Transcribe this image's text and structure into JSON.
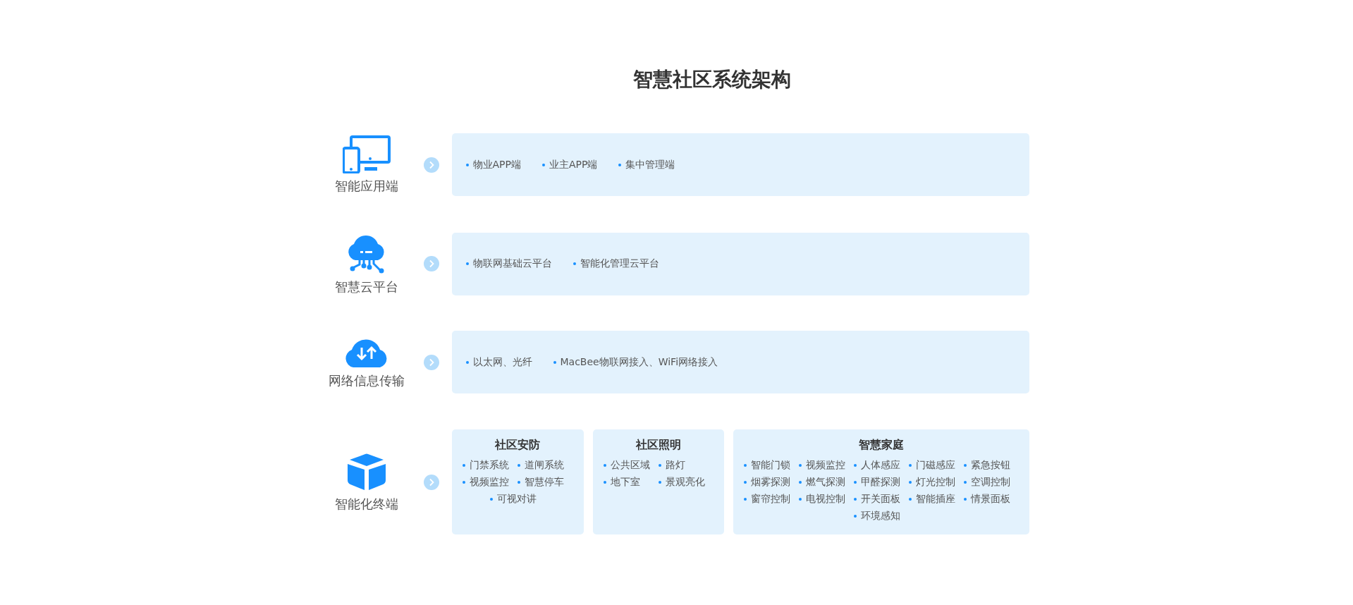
{
  "title": "智慧社区系统架构",
  "layers": [
    {
      "kind": "list",
      "label": "智能应用端",
      "items": [
        "物业APP端",
        "业主APP端",
        "集中管理端"
      ]
    },
    {
      "kind": "list",
      "label": "智慧云平台",
      "items": [
        "物联网基础云平台",
        "智能化管理云平台"
      ]
    },
    {
      "kind": "list",
      "label": "网络信息传输",
      "items": [
        "以太网、光纤",
        "MacBee物联网接入、WiFi网络接入"
      ]
    },
    {
      "kind": "groups",
      "label": "智能化终端",
      "groups": [
        {
          "title": "社区安防",
          "items": [
            "门禁系统",
            "道闸系统",
            "视频监控",
            "智慧停车",
            "可视对讲"
          ]
        },
        {
          "title": "社区照明",
          "items": [
            "公共区域",
            "路灯",
            "地下室",
            "景观亮化"
          ]
        },
        {
          "title": "智慧家庭",
          "items": [
            "智能门锁",
            "视频监控",
            "人体感应",
            "门磁感应",
            "紧急按钮",
            "烟雾探测",
            "燃气探测",
            "甲醛探测",
            "灯光控制",
            "空调控制",
            "窗帘控制",
            "电视控制",
            "开关面板",
            "智能插座",
            "情景面板",
            "环境感知"
          ]
        }
      ]
    }
  ]
}
